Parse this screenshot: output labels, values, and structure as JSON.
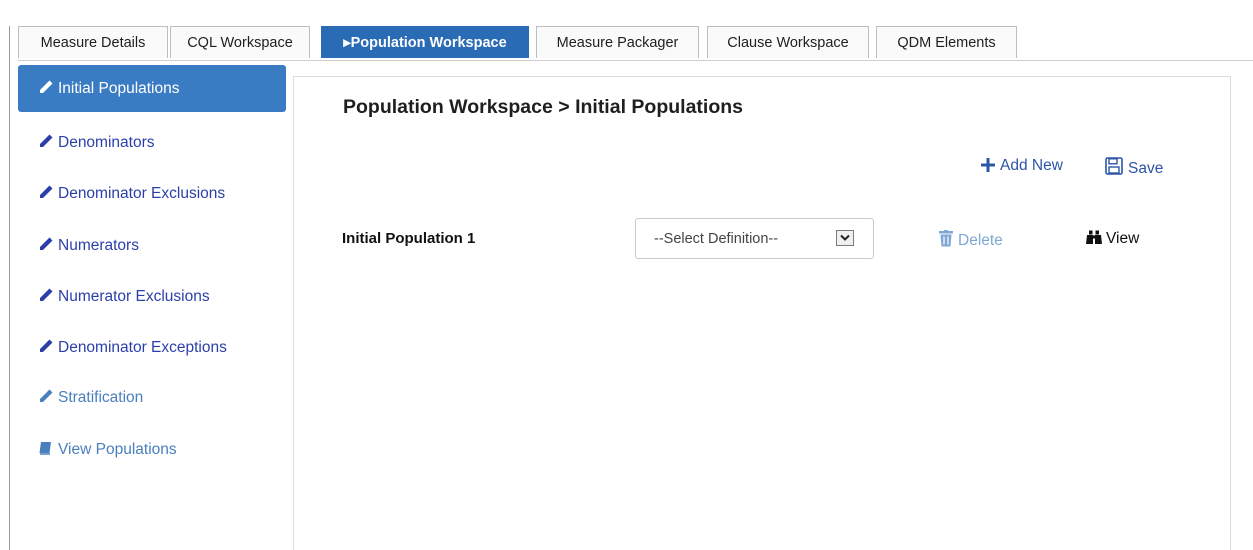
{
  "tabs": [
    {
      "label": "Measure Details",
      "active": false
    },
    {
      "label": "CQL Workspace",
      "active": false
    },
    {
      "label": "▸Population Workspace",
      "active": true
    },
    {
      "label": "Measure Packager",
      "active": false
    },
    {
      "label": "Clause Workspace",
      "active": false
    },
    {
      "label": "QDM Elements",
      "active": false
    }
  ],
  "sidebar": {
    "items": [
      {
        "label": "Initial Populations",
        "icon": "pencil-icon",
        "active": true
      },
      {
        "label": "Denominators",
        "icon": "pencil-icon"
      },
      {
        "label": "Denominator Exclusions",
        "icon": "pencil-icon"
      },
      {
        "label": "Numerators",
        "icon": "pencil-icon"
      },
      {
        "label": "Numerator Exclusions",
        "icon": "pencil-icon"
      },
      {
        "label": "Denominator Exceptions",
        "icon": "pencil-icon"
      },
      {
        "label": "Stratification",
        "icon": "pencil-icon"
      },
      {
        "label": "View Populations",
        "icon": "book-icon"
      }
    ]
  },
  "main": {
    "title": "Population Workspace > Initial Populations",
    "toolbar": {
      "add_new_label": "Add New",
      "save_label": "Save"
    },
    "population_row": {
      "label": "Initial Population 1",
      "select_value": "--Select Definition--",
      "delete_label": "Delete",
      "view_label": "View"
    }
  },
  "colors": {
    "accent": "#3a7cc3",
    "tab_active": "#2a6bb5",
    "link": "#2c3fa8",
    "disabled_link": "#7fa8d4"
  }
}
